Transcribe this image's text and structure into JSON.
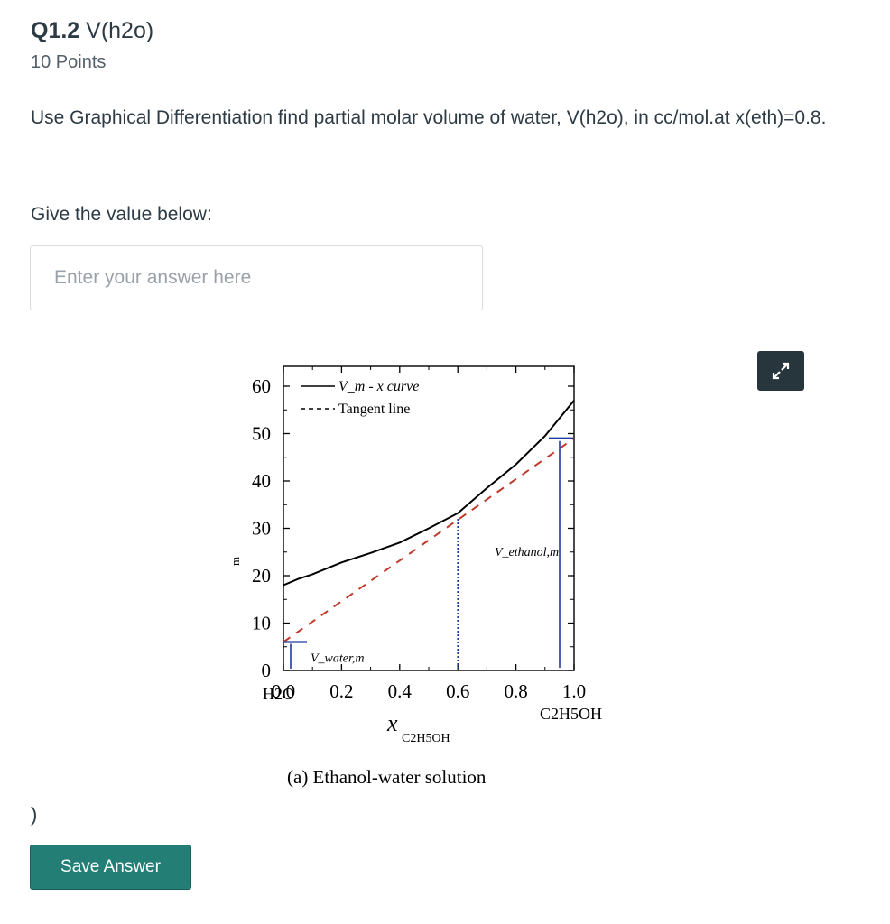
{
  "question": {
    "number": "Q1.2",
    "title": "V(h2o)",
    "points": "10 Points",
    "prompt": "Use Graphical Differentiation find partial molar volume of water, V(h2o), in cc/mol.at x(eth)=0.8.",
    "give_label": "Give the value below:",
    "stray_text": ")"
  },
  "answer": {
    "placeholder": "Enter your answer here",
    "value": ""
  },
  "save_button": {
    "label": "Save Answer"
  },
  "expand_icon": "expand-arrows-icon",
  "colors": {
    "save": "#237e76",
    "expand": "#27353d",
    "tangent": "#c0392b",
    "marker": "#1f3aa0"
  },
  "chart_data": {
    "type": "line",
    "y_ticks": [
      "0",
      "10",
      "20",
      "30",
      "40",
      "50",
      "60"
    ],
    "x_ticks": [
      "0.0",
      "0.2",
      "0.4",
      "0.6",
      "0.8",
      "1.0"
    ],
    "x_ticks_sub_left": "H2O",
    "x_ticks_sub_right": "C2H5OH",
    "xlabel": "x",
    "xlabel_sub": "C2H5OH",
    "ylabel_fragment": "m",
    "caption": "(a) Ethanol-water solution",
    "xlim": [
      0,
      1.0
    ],
    "ylim": [
      0,
      60
    ],
    "legend_placement": "top-left",
    "series": [
      {
        "name": "V_m - x curve",
        "style": "solid",
        "x": [
          0.0,
          0.05,
          0.1,
          0.2,
          0.3,
          0.4,
          0.5,
          0.6,
          0.7,
          0.8,
          0.9,
          1.0
        ],
        "y": [
          18.0,
          19.3,
          20.3,
          22.8,
          24.8,
          27.0,
          30.0,
          33.2,
          38.5,
          43.5,
          49.5,
          57.0
        ]
      },
      {
        "name": "Tangent line",
        "style": "dashed",
        "x": [
          0.0,
          1.0
        ],
        "y": [
          6.0,
          49.0
        ]
      }
    ],
    "annotations": [
      {
        "label": "V_water,m",
        "x": 0.0,
        "y": 6.0
      },
      {
        "label": "V_ethanol,m",
        "x": 1.0,
        "y": 49.0
      },
      {
        "label": "tangent point",
        "x": 0.6,
        "y": 32.0
      }
    ]
  }
}
